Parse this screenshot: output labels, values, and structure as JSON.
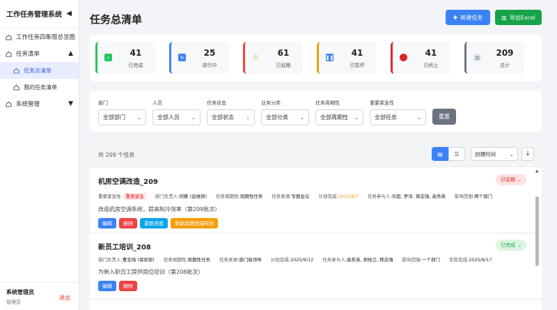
{
  "sidebar": {
    "title": "工作任务管理系统",
    "collapse_icon": "triangle-left",
    "items": [
      {
        "label": "工作任务四象限总览图"
      },
      {
        "label": "任务清单",
        "expanded": true
      },
      {
        "label": "任务总清单",
        "active": true
      },
      {
        "label": "我的任务清单"
      },
      {
        "label": "系统管理",
        "expanded": false
      }
    ],
    "user": {
      "name": "系统管理员",
      "role": "管理员",
      "logout": "退出"
    }
  },
  "header": {
    "title": "任务总清单",
    "new_button": "新建任务",
    "export_button": "导出Excel"
  },
  "stats": [
    {
      "value": "41",
      "label": "已完成",
      "color": "#22c55e",
      "icon": "check-icon"
    },
    {
      "value": "25",
      "label": "进行中",
      "color": "#3b82f6",
      "icon": "refresh-icon"
    },
    {
      "value": "61",
      "label": "已延期",
      "color": "#ef4444",
      "icon": "warning-icon"
    },
    {
      "value": "41",
      "label": "已暂停",
      "color": "#f59e0b",
      "icon": "pause-icon"
    },
    {
      "value": "41",
      "label": "已终止",
      "color": "#dc2626",
      "icon": "stop-icon"
    },
    {
      "value": "209",
      "label": "总计",
      "color": "#6b7280",
      "icon": "chart-icon"
    }
  ],
  "filters": [
    {
      "label": "部门",
      "value": "全部部门"
    },
    {
      "label": "人员",
      "value": "全部人员"
    },
    {
      "label": "任务状态",
      "value": "全部状态"
    },
    {
      "label": "业务分类",
      "value": "全部分类"
    },
    {
      "label": "任务周期性",
      "value": "全部周期性"
    },
    {
      "label": "重要紧急性",
      "value": "全部任务"
    }
  ],
  "reset_button": "重置",
  "list": {
    "total": "共 209 个任务",
    "sort": "创建时间",
    "sort_dir": "↓"
  },
  "tasks": [
    {
      "title": "机房空调改造_209",
      "status": "已延期",
      "meta": {
        "urgency_label": "重要紧急性:",
        "urgency": "重要紧急",
        "dept_label": "部门负责人:",
        "dept": "何娜 (运维部)",
        "period_label": "任务周期性:",
        "period": "周期性任务",
        "source_label": "任务来源:",
        "source": "专题会议",
        "plan_label": "计划完成:",
        "plan": "2025/8/7",
        "members_label": "任务参与人:",
        "members": "许超, 罗洋, 萧志强, 高秀英",
        "scope_label": "影响范围:",
        "scope": "两个部门"
      },
      "desc": "改造机房空调系统，提高制冷效率（第209批次）",
      "actions": [
        "编辑",
        "删除",
        "更新进度",
        "更新延期完成时间"
      ]
    },
    {
      "title": "新员工培训_208",
      "status": "已完成",
      "meta": {
        "dept_label": "部门负责人:",
        "dept": "曹志强 (保密部)",
        "period_label": "任务周期性:",
        "period": "周期性任务",
        "source_label": "任务来源:",
        "source": "部门级领导",
        "plan_label": "计划完成:",
        "plan": "2025/9/12",
        "members_label": "任务参与人:",
        "members": "高秀英, 郑桂兰, 韩志强",
        "scope_label": "影响范围:",
        "scope": "一个部门",
        "actual_label": "实际完成:",
        "actual": "2025/9/17"
      },
      "desc": "为新入职员工提供岗位培训（第208批次）",
      "actions": [
        "编辑",
        "删除"
      ]
    }
  ]
}
